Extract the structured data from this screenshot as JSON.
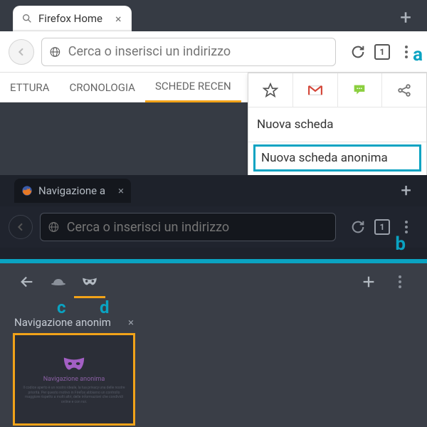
{
  "panel1": {
    "tab": {
      "label": "Firefox Home"
    },
    "urlbar": {
      "placeholder": "Cerca o inserisci un indirizzo"
    },
    "tab_count": "1",
    "home_tabs": {
      "reading": "ETTURA",
      "history": "CRONOLOGIA",
      "recent": "SCHEDE RECEN"
    },
    "popup": {
      "new_tab": "Nuova scheda",
      "new_private": "Nuova scheda anonima"
    }
  },
  "panel2": {
    "tab": {
      "label": "Navigazione a"
    },
    "urlbar": {
      "placeholder": "Cerca o inserisci un indirizzo"
    },
    "tab_count": "1"
  },
  "panel3": {
    "thumb": {
      "title": "Navigazione anonim",
      "caption": "Navigazione anonima",
      "body": "Il codice aperto è un nostro ideale, la tua privacy una delle nostre priorità. Per questo motivo in Firefox abbiamo un controllo maggiore rispetto a molti altri, delle informazioni che condividi online e con noi."
    }
  },
  "annotations": {
    "a": "a",
    "b": "b",
    "c": "c",
    "d": "d"
  },
  "colors": {
    "accent": "#0aa3c2",
    "orange": "#f2a319"
  }
}
